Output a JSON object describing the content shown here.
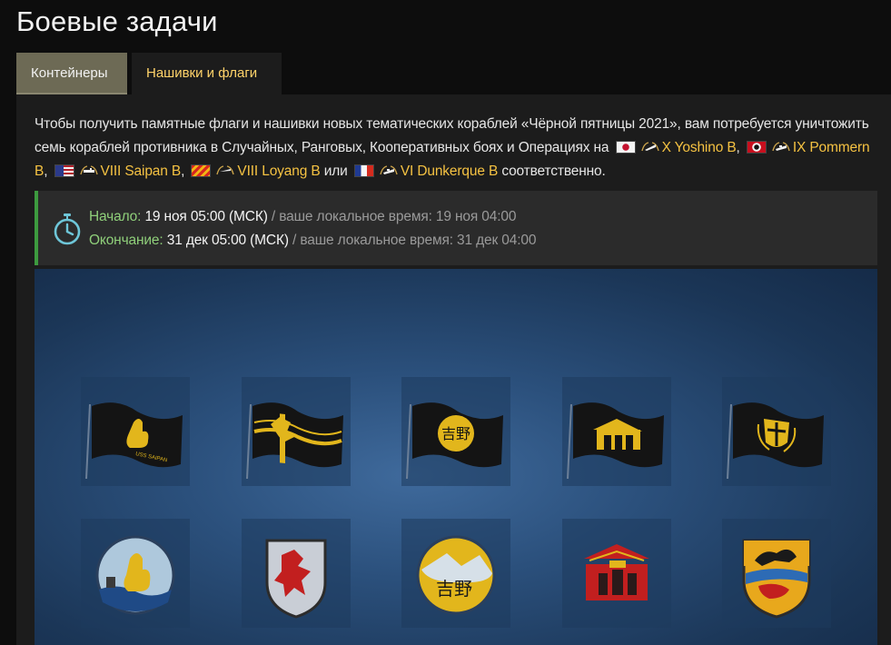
{
  "page": {
    "title": "Боевые задачи"
  },
  "tabs": [
    {
      "label": "Контейнеры",
      "active": false
    },
    {
      "label": "Нашивки и флаги",
      "active": true
    }
  ],
  "intro": {
    "text_1": "Чтобы получить памятные флаги и нашивки новых тематических кораблей «Чёрной пятницы 2021», вам потребуется уничтожить семь кораблей противника в Случайных, Ранговых, Кооперативных боях и Операциях на",
    "ships": [
      {
        "name": "X Yoshino B",
        "nation_flag": "japan-flag-icon",
        "class_icon": "cruiser-icon",
        "suffix": ","
      },
      {
        "name": "IX Pommern B",
        "nation_flag": "germany-flag-icon",
        "class_icon": "battleship-icon",
        "suffix": ","
      },
      {
        "name": "VIII Saipan B",
        "nation_flag": "usa-flag-icon",
        "class_icon": "aircraft-carrier-icon",
        "suffix": ","
      },
      {
        "name": "VIII Loyang B",
        "nation_flag": "pan-asia-flag-icon",
        "class_icon": "destroyer-icon",
        "suffix": ""
      },
      {
        "name": "VI Dunkerque B",
        "nation_flag": "france-flag-icon",
        "class_icon": "battleship-icon",
        "suffix": ""
      }
    ],
    "conj_or": "или",
    "text_end": "соответственно."
  },
  "timer": {
    "start_label": "Начало:",
    "start_value": "19 ноя 05:00 (МСК)",
    "start_local": "/ ваше локальное время: 19 ноя 04:00",
    "end_label": "Окончание:",
    "end_value": "31 дек 05:00 (МСК)",
    "end_local": "/ ваше локальное время: 31 дек 04:00"
  },
  "rewards": {
    "flags": [
      {
        "id": "flag-saipan",
        "caption": "USS SAIPAN"
      },
      {
        "id": "flag-pommern",
        "caption": ""
      },
      {
        "id": "flag-yoshino",
        "caption": "吉野"
      },
      {
        "id": "flag-loyang",
        "caption": ""
      },
      {
        "id": "flag-dunkerque",
        "caption": ""
      }
    ],
    "patches": [
      {
        "id": "patch-saipan"
      },
      {
        "id": "patch-pommern"
      },
      {
        "id": "patch-yoshino",
        "caption": "吉野"
      },
      {
        "id": "patch-loyang"
      },
      {
        "id": "patch-dunkerque"
      }
    ]
  },
  "colors": {
    "accent_gold": "#f5c242",
    "tab_active_text": "#ffd36a",
    "timer_green": "#3d9a3f",
    "banner_blue": "#2b507c"
  }
}
